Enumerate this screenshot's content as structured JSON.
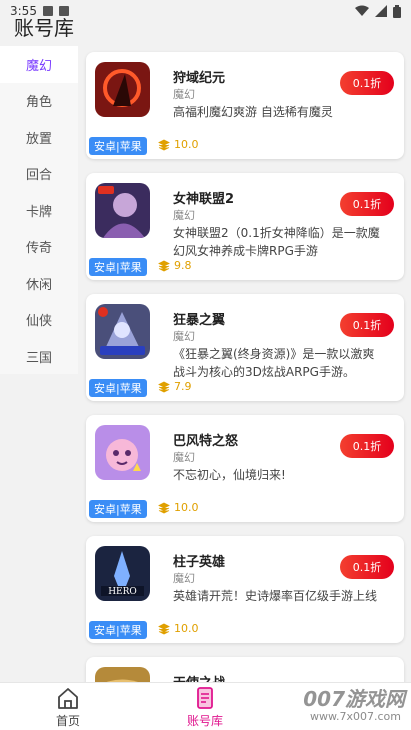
{
  "status_bar": {
    "time": "3:55"
  },
  "page_title": "账号库",
  "sidebar": {
    "items": [
      {
        "label": "魔幻",
        "active": true
      },
      {
        "label": "角色",
        "active": false
      },
      {
        "label": "放置",
        "active": false
      },
      {
        "label": "回合",
        "active": false
      },
      {
        "label": "卡牌",
        "active": false
      },
      {
        "label": "传奇",
        "active": false
      },
      {
        "label": "休闲",
        "active": false
      },
      {
        "label": "仙侠",
        "active": false
      },
      {
        "label": "三国",
        "active": false
      }
    ]
  },
  "games": [
    {
      "name": "狩域纪元",
      "category": "魔幻",
      "description": "高福利魔幻爽游 自选稀有魔灵",
      "discount": "0.1折",
      "platform": "安卓|苹果",
      "rating": "10.0",
      "thumb_color": "#7a1612"
    },
    {
      "name": "女神联盟2",
      "category": "魔幻",
      "description": "女神联盟2（0.1折女神降临）是一款魔幻风女神养成卡牌RPG手游",
      "discount": "0.1折",
      "platform": "安卓|苹果",
      "rating": "9.8",
      "thumb_color": "#3b2c5e"
    },
    {
      "name": "狂暴之翼",
      "category": "魔幻",
      "description": "《狂暴之翼(终身资源)》是一款以激爽战斗为核心的3D炫战ARPG手游。",
      "discount": "0.1折",
      "platform": "安卓|苹果",
      "rating": "7.9",
      "thumb_color": "#4a4f7a"
    },
    {
      "name": "巴风特之怒",
      "category": "魔幻",
      "description": "不忘初心，仙境归来!",
      "discount": "0.1折",
      "platform": "安卓|苹果",
      "rating": "10.0",
      "thumb_color": "#b98ee8"
    },
    {
      "name": "柱子英雄",
      "category": "魔幻",
      "description": "英雄请开荒！史诗爆率百亿级手游上线",
      "discount": "0.1折",
      "platform": "安卓|苹果",
      "rating": "10.0",
      "thumb_color": "#1b2440"
    },
    {
      "name": "天使之战",
      "category": "",
      "description": "",
      "discount": "",
      "platform": "",
      "rating": "",
      "thumb_color": "#b58a3a"
    }
  ],
  "bottom_nav": {
    "home_label": "首页",
    "account_label": "账号库",
    "active": "account"
  },
  "watermark": {
    "text": "007游戏网",
    "url": "www.7x007.com"
  },
  "colors": {
    "accent": "#7a3cff",
    "discount": "#e4001c",
    "platform": "#3a8df6",
    "rating": "#e0a000",
    "nav_active": "#e0168e"
  }
}
